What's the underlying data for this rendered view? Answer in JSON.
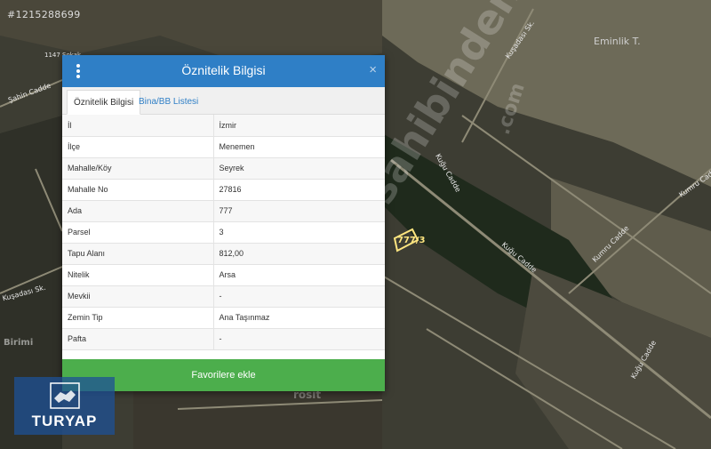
{
  "listing_id": "#1215288699",
  "map": {
    "labels": [
      "Eminlik T.",
      "Kuşadası Sk.",
      "Kumru Cadde",
      "Şahin Cadde",
      "Kuğu Cadde",
      "Kuğu Cadde",
      "Kumru Cadde",
      "Kuğu Cadde",
      "1147 Sokak",
      "Kuşadası Sk."
    ],
    "parcel_label": "777/3"
  },
  "watermark": {
    "brand": "sahibinden",
    "domain": ".com",
    "left_partial": "Birimi",
    "bottom_partial": "rosit"
  },
  "modal": {
    "title": "Öznitelik Bilgisi",
    "close_symbol": "×",
    "tabs": [
      {
        "label": "Öznitelik Bilgisi",
        "active": true
      },
      {
        "label": "Bina/BB Listesi",
        "active": false
      }
    ],
    "rows": [
      {
        "key": "İl",
        "value": "İzmir"
      },
      {
        "key": "İlçe",
        "value": "Menemen"
      },
      {
        "key": "Mahalle/Köy",
        "value": "Seyrek"
      },
      {
        "key": "Mahalle No",
        "value": "27816"
      },
      {
        "key": "Ada",
        "value": "777"
      },
      {
        "key": "Parsel",
        "value": "3"
      },
      {
        "key": "Tapu Alanı",
        "value": "812,00"
      },
      {
        "key": "Nitelik",
        "value": "Arsa"
      },
      {
        "key": "Mevkii",
        "value": "-"
      },
      {
        "key": "Zemin Tip",
        "value": "Ana Taşınmaz"
      },
      {
        "key": "Pafta",
        "value": "-"
      }
    ],
    "favorite_button": "Favorilere ekle"
  },
  "logo": {
    "text": "TURYAP"
  },
  "colors": {
    "header": "#2f7fc6",
    "button": "#4cae4c",
    "tab_link": "#2f7fc6"
  }
}
